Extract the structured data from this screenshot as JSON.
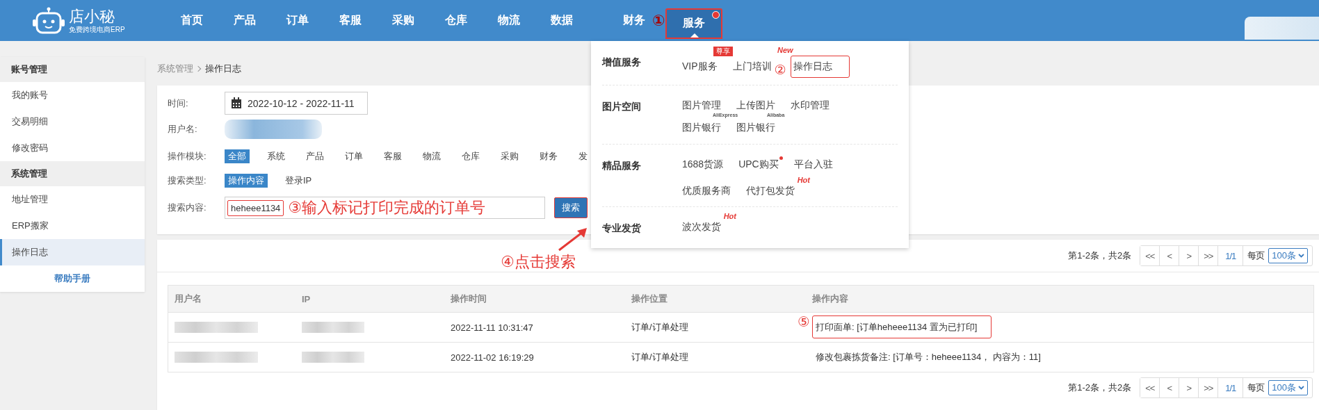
{
  "header": {
    "logo_name": "店小秘",
    "logo_tagline": "免费跨境电商ERP",
    "nav": [
      {
        "label": "首页",
        "selected": false
      },
      {
        "label": "产品",
        "selected": false
      },
      {
        "label": "订单",
        "selected": false
      },
      {
        "label": "客服",
        "selected": false
      },
      {
        "label": "采购",
        "selected": false
      },
      {
        "label": "仓库",
        "selected": false
      },
      {
        "label": "物流",
        "selected": false
      },
      {
        "label": "数据",
        "selected": false
      }
    ],
    "nav_right": [
      {
        "label": "财务",
        "selected": false,
        "highlighted": false,
        "dot": false,
        "callout": "①"
      },
      {
        "label": "服务",
        "selected": true,
        "highlighted": true,
        "dot": true
      }
    ]
  },
  "service_menu": {
    "sections": [
      {
        "title": "增值服务",
        "rows": [
          [
            {
              "label": "VIP服务",
              "badge": {
                "kind": "tag",
                "text": "尊享"
              },
              "highlighted": false
            },
            {
              "label": "上门培训",
              "badge": {
                "kind": "new",
                "text": "New"
              },
              "highlighted": false,
              "callout": "②"
            },
            {
              "label": "操作日志",
              "highlighted": true
            }
          ]
        ]
      },
      {
        "title": "图片空间",
        "rows": [
          [
            {
              "label": "图片管理",
              "highlighted": false
            },
            {
              "label": "上传图片",
              "highlighted": false
            },
            {
              "label": "水印管理",
              "highlighted": false
            }
          ],
          [
            {
              "label": "图片银行",
              "badge": {
                "kind": "sup",
                "text": "AliExpress"
              },
              "highlighted": false
            },
            {
              "label": "图片银行",
              "badge": {
                "kind": "sup",
                "text": "Alibaba"
              },
              "highlighted": false
            }
          ]
        ]
      },
      {
        "title": "精品服务",
        "rows": [
          [
            {
              "label": "1688货源",
              "highlighted": false
            },
            {
              "label": "UPC购买",
              "badge": {
                "kind": "dot"
              },
              "highlighted": false
            },
            {
              "label": "平台入驻",
              "highlighted": false
            }
          ],
          [
            {
              "label": "优质服务商",
              "highlighted": false
            },
            {
              "label": "代打包发货",
              "badge": {
                "kind": "hot",
                "text": "Hot"
              },
              "highlighted": false
            }
          ]
        ]
      },
      {
        "title": "专业发货",
        "rows": [
          [
            {
              "label": "波次发货",
              "badge": {
                "kind": "hot",
                "text": "Hot"
              },
              "highlighted": false
            }
          ]
        ]
      }
    ]
  },
  "sidebar": {
    "groups": [
      {
        "title": "账号管理",
        "items": [
          {
            "label": "我的账号",
            "selected": false
          },
          {
            "label": "交易明细",
            "selected": false
          },
          {
            "label": "修改密码",
            "selected": false
          }
        ]
      },
      {
        "title": "系统管理",
        "items": [
          {
            "label": "地址管理",
            "selected": false
          },
          {
            "label": "ERP搬家",
            "selected": false
          },
          {
            "label": "操作日志",
            "selected": true
          }
        ]
      }
    ],
    "help": "帮助手册"
  },
  "breadcrumb": {
    "parent": "系统管理",
    "current": "操作日志"
  },
  "filters": {
    "time": {
      "label": "时间:",
      "value": "2022-10-12 - 2022-11-11"
    },
    "user": {
      "label": "用户名:"
    },
    "module": {
      "label": "操作模块:",
      "options": [
        {
          "label": "全部",
          "selected": true
        },
        {
          "label": "系统",
          "selected": false
        },
        {
          "label": "产品",
          "selected": false
        },
        {
          "label": "订单",
          "selected": false
        },
        {
          "label": "客服",
          "selected": false
        },
        {
          "label": "物流",
          "selected": false
        },
        {
          "label": "仓库",
          "selected": false
        },
        {
          "label": "采购",
          "selected": false
        },
        {
          "label": "财务",
          "selected": false
        },
        {
          "label": "发",
          "selected": false
        }
      ]
    },
    "search_type": {
      "label": "搜索类型:",
      "options": [
        {
          "label": "操作内容",
          "selected": true
        },
        {
          "label": "登录IP",
          "selected": false
        }
      ]
    },
    "search": {
      "label": "搜索内容:",
      "value": "heheee1134",
      "callout": "③输入标记打印完成的订单号",
      "button": "搜索",
      "button_callout": "④点击搜索"
    }
  },
  "results": {
    "pagination_top": {
      "summary": "第1-2条，共2条",
      "buttons": [
        "<<",
        "<",
        ">",
        ">>"
      ],
      "page": "1/1",
      "per_page_label": "每页",
      "per_page": "100条"
    },
    "table": {
      "columns": [
        "用户名",
        "IP",
        "操作时间",
        "操作位置",
        "操作内容"
      ],
      "rows": [
        {
          "time": "2022-11-11 10:31:47",
          "location": "订单/订单处理",
          "content": "打印面单: [订单heheee1134 置为已打印]",
          "highlighted": true,
          "callout": "⑤"
        },
        {
          "time": "2022-11-02 16:19:29",
          "location": "订单/订单处理",
          "content": "修改包裹拣货备注: [订单号：heheee1134， 内容为：11]",
          "highlighted": false
        }
      ]
    },
    "pagination_bottom": {
      "summary": "第1-2条，共2条",
      "buttons": [
        "<<",
        "<",
        ">",
        ">>"
      ],
      "page": "1/1",
      "per_page_label": "每页",
      "per_page": "100条"
    }
  }
}
